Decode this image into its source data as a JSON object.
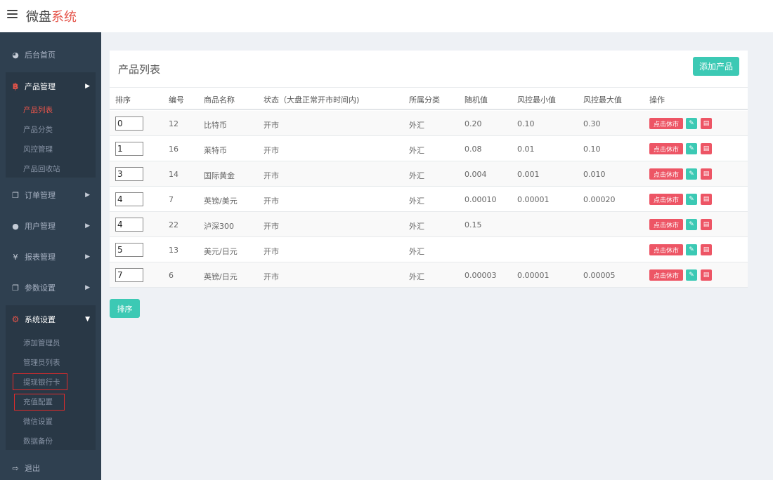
{
  "header": {
    "brand_main": "微盘",
    "brand_accent": "系统",
    "menu_icon": "hamburger-icon"
  },
  "sidebar": {
    "dashboard": {
      "label": "后台首页",
      "icon": "dashboard-icon"
    },
    "product_group": {
      "label": "产品管理",
      "icon": "bitcoin-icon",
      "items": [
        {
          "label": "产品列表",
          "active": true
        },
        {
          "label": "产品分类"
        },
        {
          "label": "风控管理"
        },
        {
          "label": "产品回收站"
        }
      ]
    },
    "orders": {
      "label": "订单管理",
      "icon": "copy-icon"
    },
    "users": {
      "label": "用户管理",
      "icon": "user-icon"
    },
    "reports": {
      "label": "报表管理",
      "icon": "yen-icon"
    },
    "params": {
      "label": "参数设置",
      "icon": "copy-icon"
    },
    "system_group": {
      "label": "系统设置",
      "icon": "gears-icon",
      "items": [
        {
          "label": "添加管理员"
        },
        {
          "label": "管理员列表"
        },
        {
          "label": "提现银行卡",
          "highlighted": true
        },
        {
          "label": "充值配置",
          "highlighted": true
        },
        {
          "label": "微信设置"
        },
        {
          "label": "数据备份"
        }
      ]
    },
    "logout": {
      "label": "退出",
      "icon": "sign-out-icon"
    }
  },
  "panel": {
    "title": "产品列表",
    "add_button": "添加产品",
    "columns": [
      "排序",
      "编号",
      "商品名称",
      "状态（大盘正常开市时间内)",
      "所属分类",
      "随机值",
      "风控最小值",
      "风控最大值",
      "操作"
    ],
    "rows": [
      {
        "sort": "0",
        "id": "12",
        "name": "比特币",
        "status": "开市",
        "category": "外汇",
        "random": "0.20",
        "min": "0.10",
        "max": "0.30"
      },
      {
        "sort": "1",
        "id": "16",
        "name": "莱特币",
        "status": "开市",
        "category": "外汇",
        "random": "0.08",
        "min": "0.01",
        "max": "0.10"
      },
      {
        "sort": "3",
        "id": "14",
        "name": "国际黄金",
        "status": "开市",
        "category": "外汇",
        "random": "0.004",
        "min": "0.001",
        "max": "0.010"
      },
      {
        "sort": "4",
        "id": "7",
        "name": "英镑/美元",
        "status": "开市",
        "category": "外汇",
        "random": "0.00010",
        "min": "0.00001",
        "max": "0.00020"
      },
      {
        "sort": "4",
        "id": "22",
        "name": "泸深300",
        "status": "开市",
        "category": "外汇",
        "random": "0.15",
        "min": "",
        "max": ""
      },
      {
        "sort": "5",
        "id": "13",
        "name": "美元/日元",
        "status": "开市",
        "category": "外汇",
        "random": "",
        "min": "",
        "max": ""
      },
      {
        "sort": "7",
        "id": "6",
        "name": "英镑/日元",
        "status": "开市",
        "category": "外汇",
        "random": "0.00003",
        "min": "0.00001",
        "max": "0.00005"
      }
    ],
    "action_close_label": "点击休市",
    "action_edit_icon": "pencil-icon",
    "action_delete_icon": "trash-icon"
  },
  "sort_button": "排序",
  "colors": {
    "sidebar_bg": "#2f4050",
    "accent_red": "#e5544a",
    "teal": "#3cc9b4",
    "danger": "#ed5565"
  }
}
